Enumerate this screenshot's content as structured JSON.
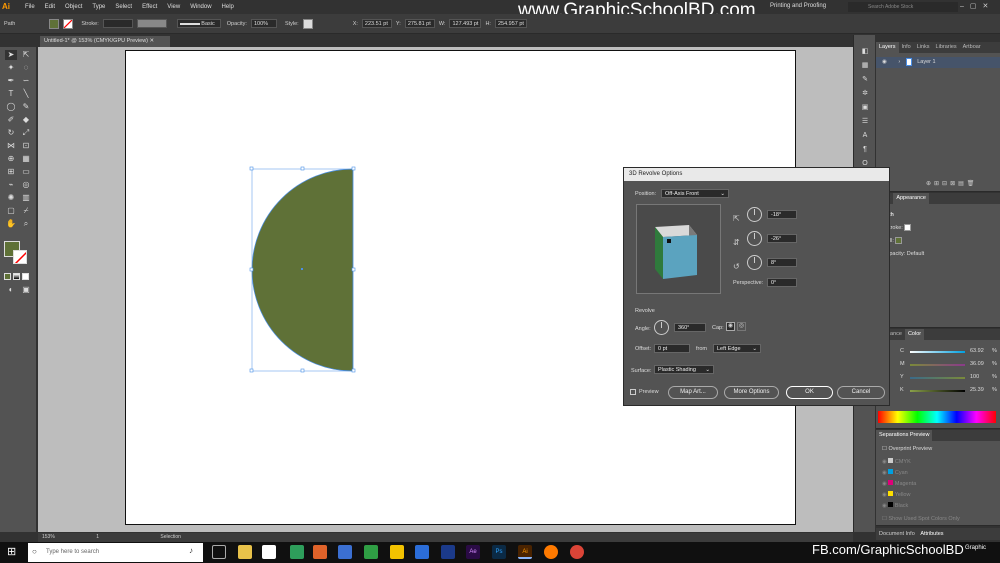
{
  "app": {
    "logo": "Ai"
  },
  "menu": [
    "File",
    "Edit",
    "Object",
    "Type",
    "Select",
    "Effect",
    "View",
    "Window",
    "Help"
  ],
  "workspace": "Printing and Proofing",
  "search_placeholder": "Search Adobe Stock",
  "control": {
    "object": "Path",
    "stroke_label": "Stroke:",
    "brush": "Basic",
    "opacity_label": "Opacity:",
    "opacity": "100%",
    "style_label": "Style:",
    "x": "223.51 pt",
    "y": "275.81 pt",
    "w": "127.493 pt",
    "h": "254.957 pt"
  },
  "document_tab": "Untitled-1* @ 153% (CMYK/GPU Preview)",
  "status": {
    "zoom": "153%",
    "page": "1",
    "mode": "Selection"
  },
  "watermark": "www.GraphicSchoolBD.com",
  "footer_watermark": "FB.com/GraphicSchoolBD",
  "colors": {
    "fill": "#5f7137",
    "accent": "#4a8fe7",
    "cube_front": "#5ba3bf",
    "cube_top": "#d9d9d9",
    "cube_side": "#7a7a7a"
  },
  "layers_panel": {
    "tabs": [
      "Layers",
      "Info",
      "Links",
      "Libraries",
      "Artboar"
    ],
    "layer": "Layer 1"
  },
  "appearance_panel": {
    "tabs": [
      "ctive",
      "Appearance"
    ],
    "title": "Path",
    "stroke": "Stroke:",
    "fill": "Fill:",
    "opacity": "Opacity:",
    "opacity_value": "Default"
  },
  "color_panel": {
    "tabs": [
      "pearance",
      "Color"
    ],
    "c_label": "C",
    "c": "63.92",
    "m_label": "M",
    "m": "36.09",
    "y_label": "Y",
    "y": "100",
    "k_label": "K",
    "k": "25.39",
    "unit": "%"
  },
  "separations": {
    "title": "Separations Preview",
    "overprint": "Overprint Preview",
    "inks": [
      "CMYK",
      "Cyan",
      "Magenta",
      "Yellow",
      "Black"
    ],
    "footer": "Show Used Spot Colors Only"
  },
  "bottom_tabs": [
    "Document Info",
    "Attributes"
  ],
  "dialog": {
    "title": "3D Revolve Options",
    "position_label": "Position:",
    "position_value": "Off-Axis Front",
    "angle_x": "-18°",
    "angle_y": "-26°",
    "angle_z": "8°",
    "perspective_label": "Perspective:",
    "perspective": "0°",
    "revolve_heading": "Revolve",
    "angle_label": "Angle:",
    "angle": "360°",
    "cap_label": "Cap:",
    "offset_label": "Offset:",
    "offset": "0 pt",
    "from_label": "from",
    "from_value": "Left Edge",
    "surface_label": "Surface:",
    "surface_value": "Plastic Shading",
    "preview_label": "Preview",
    "map_art": "Map Art...",
    "more_options": "More Options",
    "ok": "OK",
    "cancel": "Cancel"
  },
  "taskbar": {
    "search": "Type here to search"
  }
}
